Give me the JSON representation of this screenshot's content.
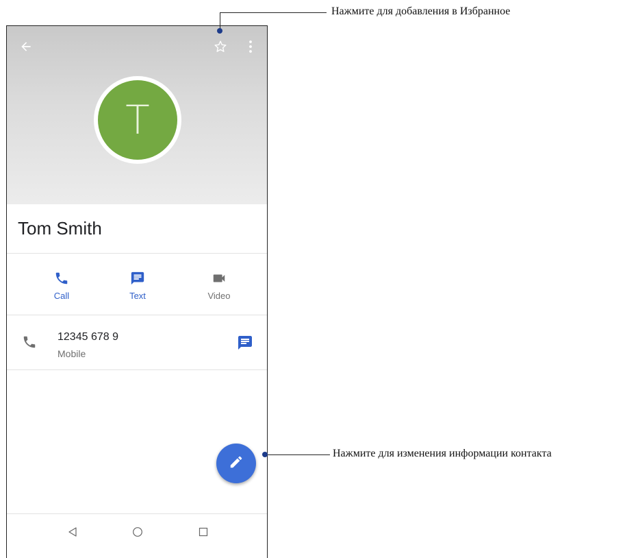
{
  "contact": {
    "avatar_letter": "T",
    "name": "Tom Smith"
  },
  "actions": [
    {
      "label": "Call",
      "color": "#2f5fc9"
    },
    {
      "label": "Text",
      "color": "#2f5fc9"
    },
    {
      "label": "Video",
      "color": "#6f6f6f"
    }
  ],
  "phone_entry": {
    "number": "12345 678 9",
    "type": "Mobile"
  },
  "callouts": {
    "favorite": "Нажмите для добавления в Избранное",
    "edit": "Нажмите для изменения информации контакта"
  },
  "icons": [
    "back-arrow-icon",
    "star-outline-icon",
    "more-vert-icon",
    "phone-icon",
    "message-icon",
    "video-icon",
    "pencil-icon",
    "nav-back-icon",
    "nav-home-icon",
    "nav-recent-icon"
  ],
  "colors": {
    "accent": "#3d6fd8",
    "avatar": "#74a942",
    "callout_dot": "#1d3b8a"
  }
}
